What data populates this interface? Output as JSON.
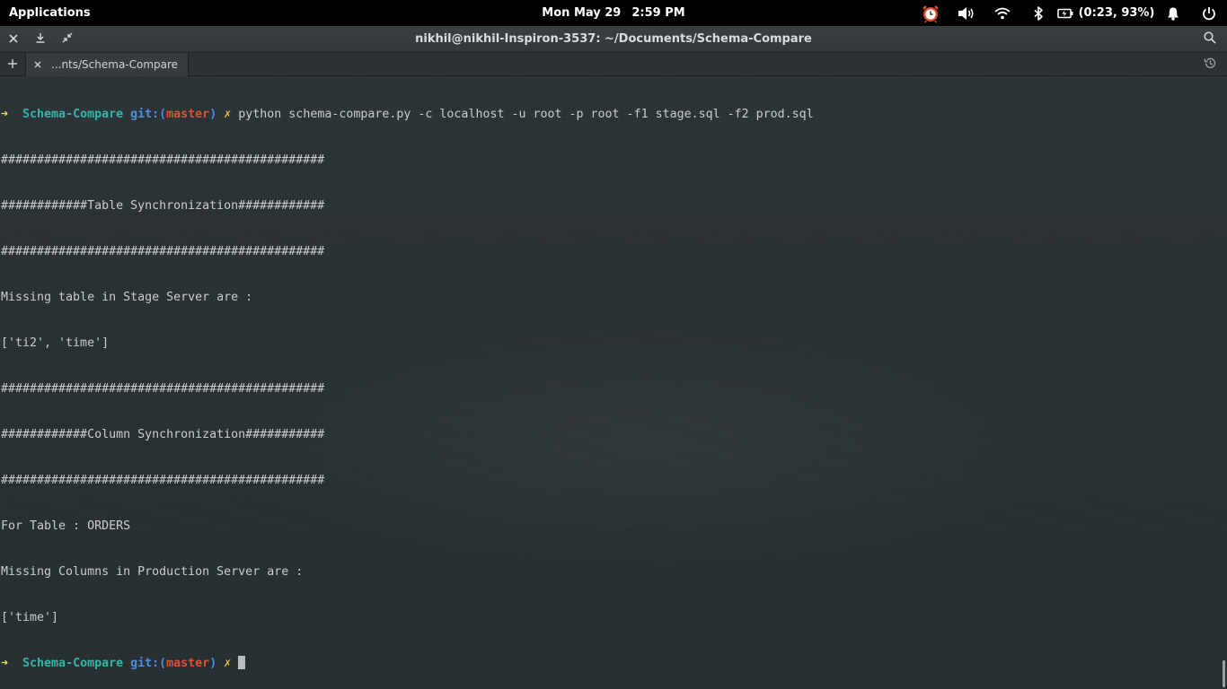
{
  "panel": {
    "applications_label": "Applications",
    "date": "Mon May 29",
    "time": "2:59 PM",
    "battery_text": "(0:23, 93%)",
    "icons": [
      "alarm-clock-icon",
      "volume-icon",
      "wifi-icon",
      "bluetooth-icon",
      "battery-icon",
      "notification-bell-icon",
      "power-icon"
    ]
  },
  "window": {
    "title": "nikhil@nikhil-Inspiron-3537: ~/Documents/Schema-Compare",
    "left_buttons": [
      "close-icon",
      "download-icon",
      "unmaximize-icon"
    ],
    "right_button": "search-icon"
  },
  "tabs": {
    "new_tab_icon": "plus-icon",
    "history_icon": "history-icon",
    "items": [
      {
        "label": "...nts/Schema-Compare",
        "close_icon": "close-icon"
      }
    ]
  },
  "terminal": {
    "prompt": {
      "arrow": "➜",
      "dir": "Schema-Compare",
      "git_prefix": "git:(",
      "branch": "master",
      "git_suffix": ")",
      "dirty_mark": "✗"
    },
    "command": "python schema-compare.py -c localhost -u root -p root -f1 stage.sql -f2 prod.sql",
    "output": [
      "#############################################",
      "############Table Synchronization############",
      "#############################################",
      "Missing table in Stage Server are :",
      "['ti2', 'time']",
      "#############################################",
      "############Column Synchronization###########",
      "#############################################",
      "For Table : ORDERS",
      "Missing Columns in Production Server are :",
      "['time']"
    ]
  },
  "colors": {
    "panel_bg": "#000000",
    "terminal_bg": "#2a3134",
    "prompt_arrow": "#e8de4c",
    "prompt_dir": "#2fb8a8",
    "prompt_git": "#4b8fe0",
    "prompt_branch": "#e0522f",
    "alarm_icon": "#e24b2c"
  }
}
